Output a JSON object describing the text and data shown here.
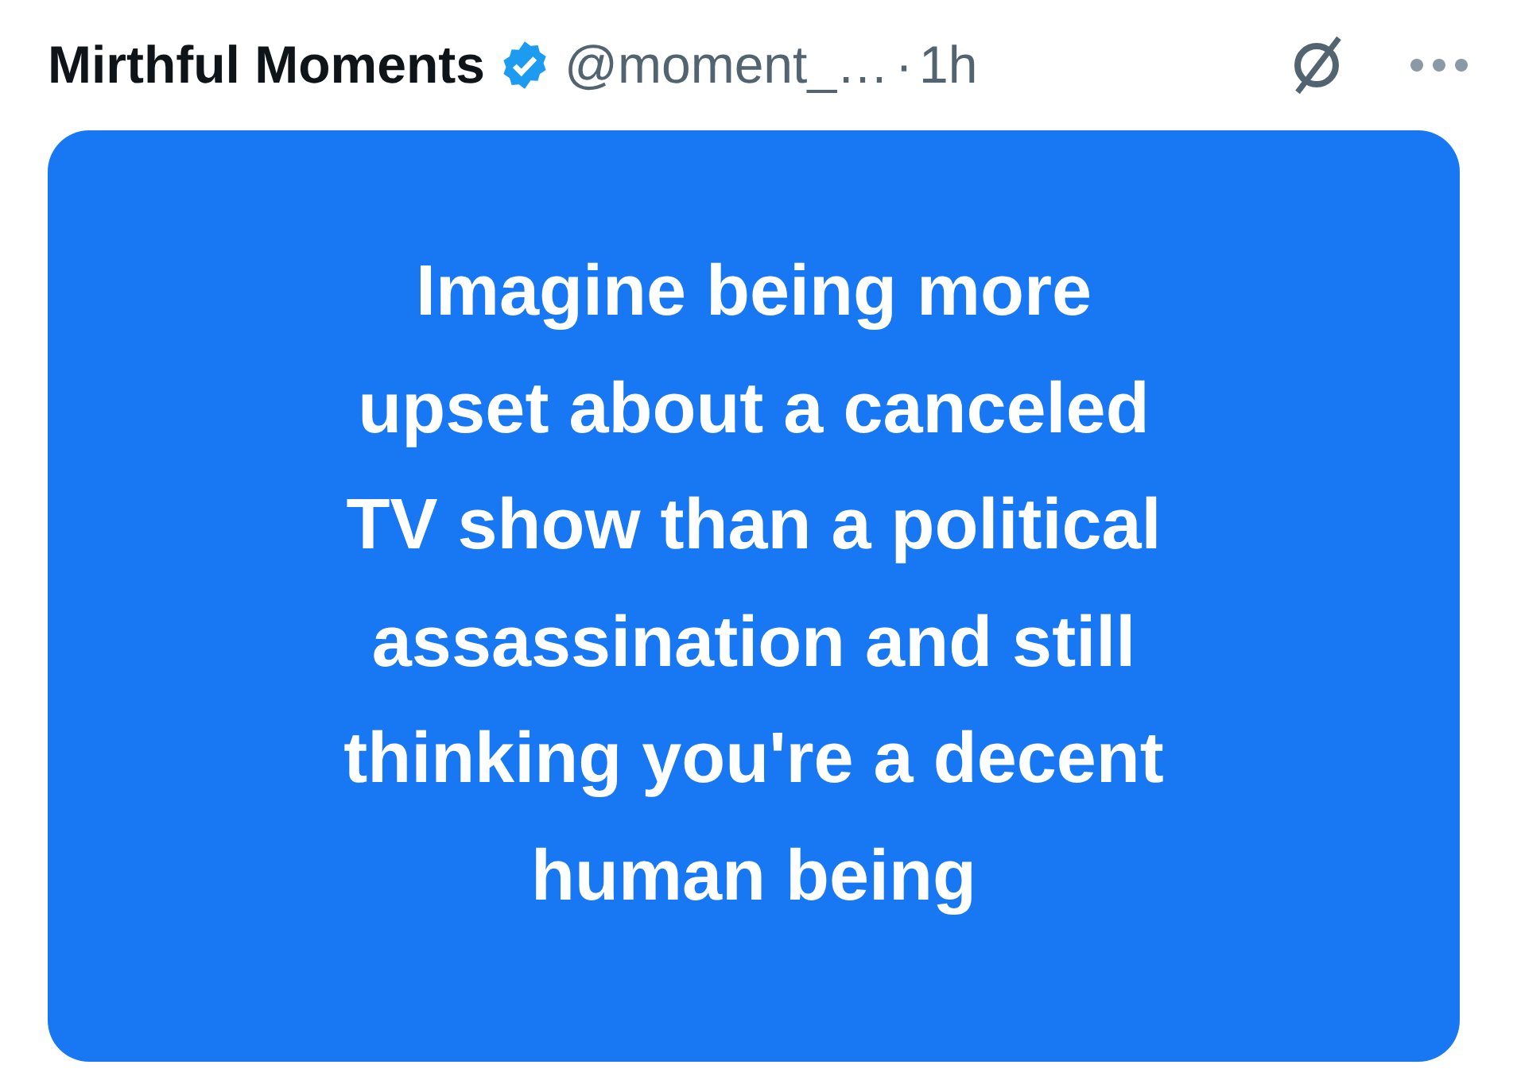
{
  "post": {
    "author": "Mirthful Moments",
    "verified": true,
    "handle": "@moment_…",
    "separator": "·",
    "time": "1h"
  },
  "image_card": {
    "lines": [
      "Imagine being more",
      "upset about a canceled",
      "TV show than a political",
      "assassination and still",
      "thinking you're a decent",
      "human being"
    ]
  }
}
